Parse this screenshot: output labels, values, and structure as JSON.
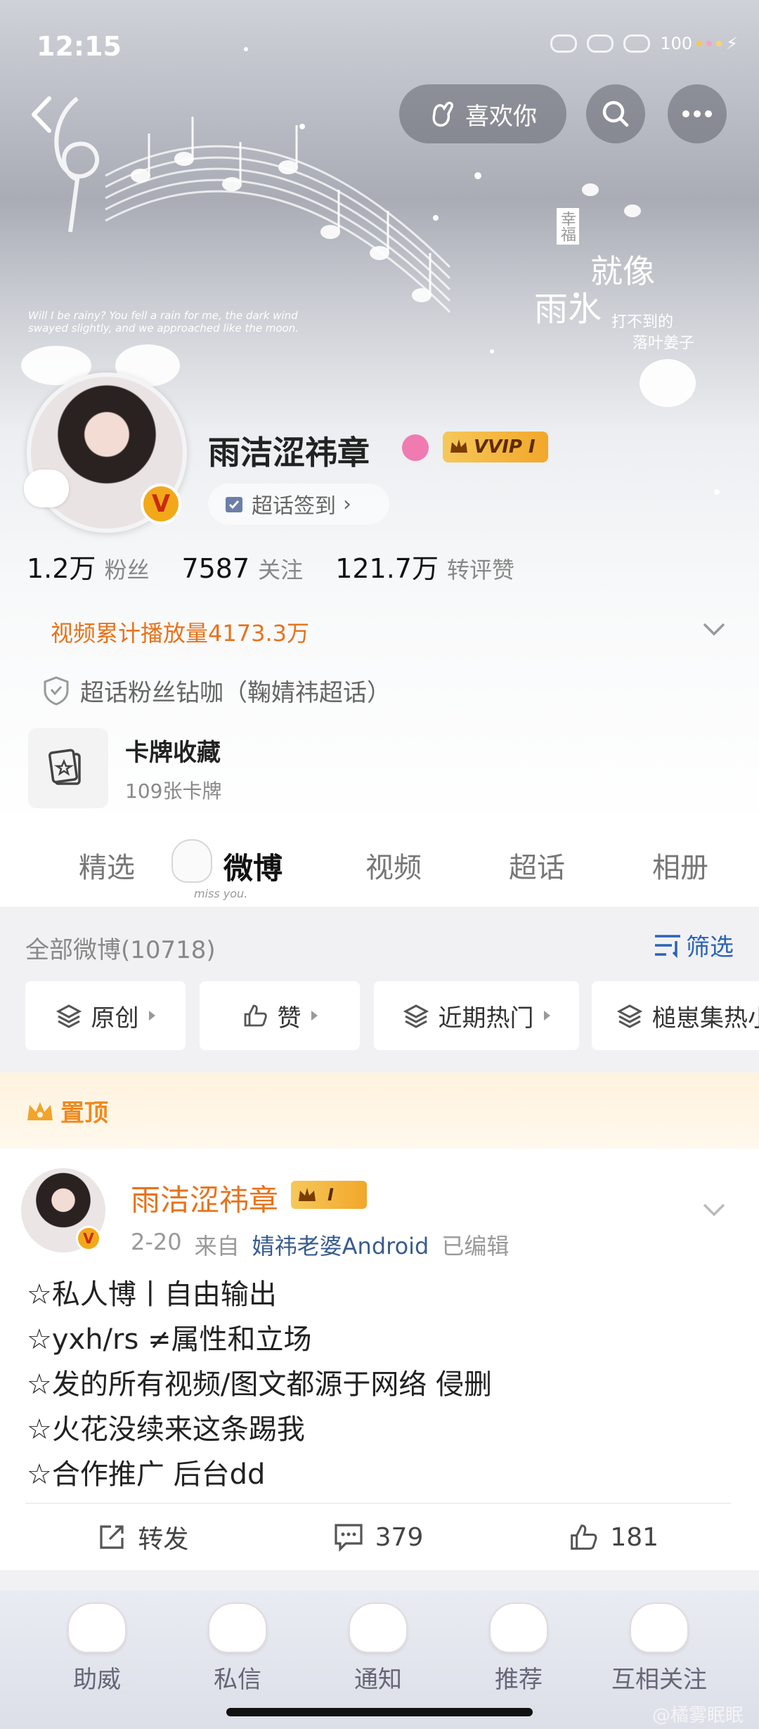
{
  "status_bar": {
    "time": "12:15",
    "battery": "100"
  },
  "header": {
    "like_label": "喜欢你"
  },
  "banner_texts": {
    "english_poem": "Will I be rainy? You fell a rain for me, the dark wind swayed slightly, and we approached like the moon.",
    "chinese_tag_small": "幸福",
    "chinese_art_1": "就像",
    "chinese_art_2": "雨水",
    "chinese_art_3": "打不到的",
    "chinese_art_4": "落叶姜子"
  },
  "profile": {
    "username": "雨洁涩祎章",
    "vip_label": "VVIP I",
    "avatar_badge": "V",
    "checkin_label": "超话签到",
    "stats": [
      {
        "num": "1.2万",
        "label": "粉丝"
      },
      {
        "num": "7587",
        "label": "关注"
      },
      {
        "num": "121.7万",
        "label": "转评赞"
      }
    ],
    "video_plays": "视频累计播放量4173.3万",
    "superfan": "超话粉丝钻咖（鞠婧祎超话）",
    "card_collection": {
      "title": "卡牌收藏",
      "subtitle": "109张卡牌"
    }
  },
  "tabs": [
    {
      "label": "精选",
      "active": false
    },
    {
      "label": "微博",
      "active": true
    },
    {
      "label": "视频",
      "active": false
    },
    {
      "label": "超话",
      "active": false
    },
    {
      "label": "相册",
      "active": false
    }
  ],
  "tab_decoration": "miss you.",
  "feed": {
    "header": "全部微博(10718)",
    "filter_label": "筛选",
    "chips": [
      "原创",
      "赞",
      "近期热门",
      "槌崽集热小"
    ],
    "pinned_label": "置顶",
    "post": {
      "author": "雨洁涩祎章",
      "vip_label": "I",
      "date": "2-20",
      "from_label": "来自",
      "source": "婧祎老婆Android",
      "edited": "已编辑",
      "lines": [
        "☆私人博丨自由输出",
        "☆yxh/rs ≠属性和立场",
        "☆发的所有视频/图文都源于网络 侵删",
        "☆火花没续来这条踢我",
        "☆合作推广 后台dd"
      ],
      "actions": {
        "repost": "转发",
        "comments": "379",
        "likes": "181"
      }
    }
  },
  "bottom_nav": [
    "助威",
    "私信",
    "通知",
    "推荐",
    "互相关注"
  ],
  "watermark": "@橘雾眠眠",
  "colors": {
    "accent_orange": "#e8721b",
    "link_blue": "#2a63b8",
    "vip_gold": "#f2a72a"
  }
}
